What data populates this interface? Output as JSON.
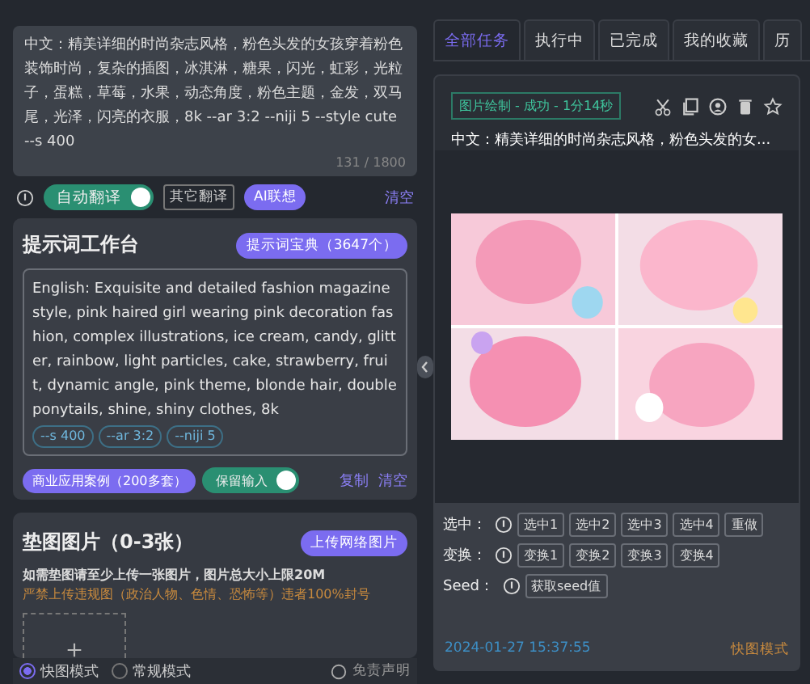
{
  "prompt_input": {
    "value": "中文：精美详细的时尚杂志风格，粉色头发的女孩穿着粉色装饰时尚，复杂的插图，冰淇淋，糖果，闪光，虹彩，光粒子，蛋糕，草莓，水果，动态角度，粉色主题，金发，双马尾，光泽，闪亮的衣服，8k --ar 3:2 --niji 5 --style cute --s 400",
    "counter": "131 / 1800"
  },
  "translate_bar": {
    "auto_translate": {
      "label": "自动翻译",
      "on": true
    },
    "other_translate": "其它翻译",
    "ai_button": "AI联想",
    "clear": "清空"
  },
  "workbench": {
    "title": "提示词工作台",
    "library_button": "提示词宝典（3647个）",
    "english": "English: Exquisite and detailed fashion magazine style, pink haired girl wearing pink decoration fashion, complex illustrations, ice cream, candy, glitter, rainbow, light particles, cake, strawberry, fruit, dynamic angle, pink theme, blonde hair, double ponytails, shine, shiny clothes, 8k",
    "tags": [
      "--s 400",
      "--ar 3:2",
      "--niji 5"
    ],
    "cases_button": "商业应用案例（200多套）",
    "keep_input": {
      "label": "保留输入",
      "on": true
    },
    "copy": "复制",
    "clear": "清空"
  },
  "pad_images": {
    "title": "垫图图片（0-3张）",
    "upload_button": "上传网络图片",
    "hint": "如需垫图请至少上传一张图片，图片总大小上限20M",
    "warning": "严禁上传违规图（政治人物、色情、恐怖等）违者100%封号"
  },
  "modes": [
    {
      "label": "快图模式",
      "selected": true
    },
    {
      "label": "常规模式",
      "selected": false
    }
  ],
  "disclaimer": "免责声明",
  "tabs": [
    {
      "label": "全部任务",
      "selected": true
    },
    {
      "label": "执行中",
      "selected": false
    },
    {
      "label": "已完成",
      "selected": false
    },
    {
      "label": "我的收藏",
      "selected": false
    },
    {
      "label": "历",
      "selected": false
    }
  ],
  "task": {
    "status": "图片绘制 - 成功 - 1分14秒",
    "prompt": "中文：精美详细的时尚杂志风格，粉色头发的女...",
    "action_rows": [
      {
        "label": "选中：",
        "buttons": [
          "选中1",
          "选中2",
          "选中3",
          "选中4",
          "重做"
        ]
      },
      {
        "label": "变换：",
        "buttons": [
          "变换1",
          "变换2",
          "变换3",
          "变换4"
        ]
      },
      {
        "label": "Seed：",
        "buttons": [
          "获取seed值"
        ]
      }
    ],
    "time": "2024-01-27 15:37:55",
    "mode": "快图模式"
  }
}
